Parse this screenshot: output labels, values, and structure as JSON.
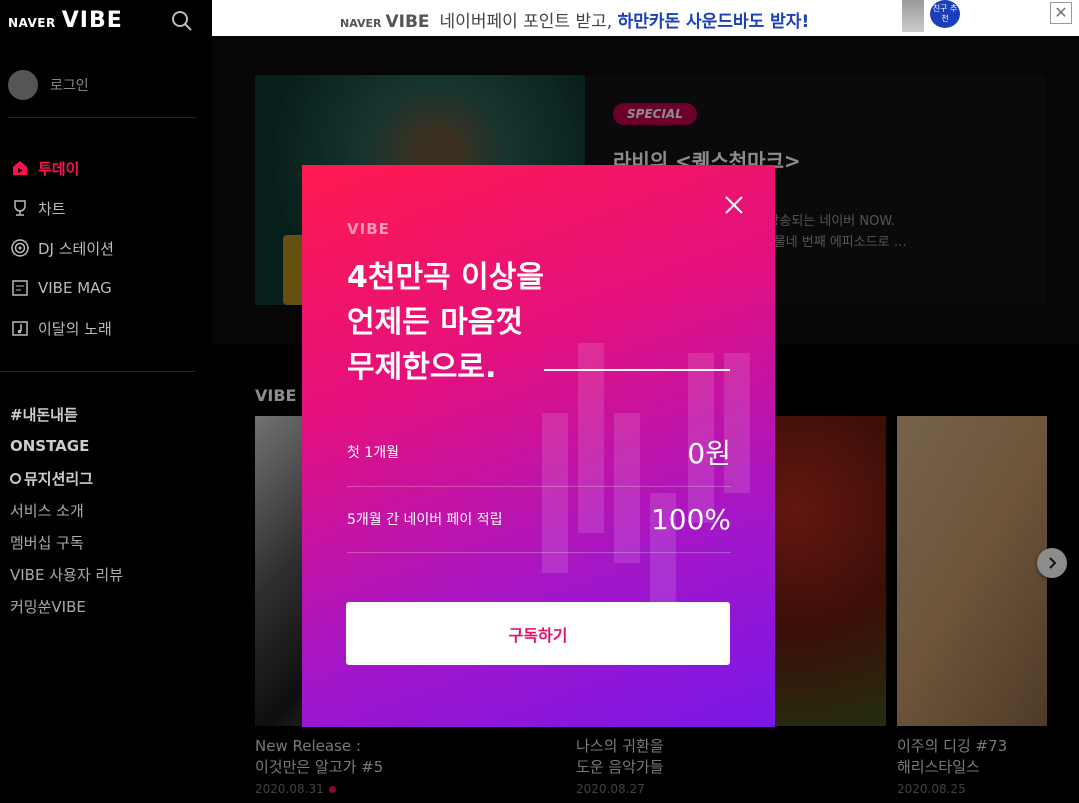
{
  "app": {
    "naver_label": "NAVER",
    "vibe_label": "VIBE"
  },
  "sidebar": {
    "login_label": "로그인",
    "nav": [
      {
        "label": "투데이",
        "icon": "home-icon",
        "active": true
      },
      {
        "label": "차트",
        "icon": "trophy-icon",
        "active": false
      },
      {
        "label": "DJ 스테이션",
        "icon": "radio-icon",
        "active": false
      },
      {
        "label": "VIBE MAG",
        "icon": "magazine-icon",
        "active": false
      },
      {
        "label": "이달의 노래",
        "icon": "music-note-icon",
        "active": false
      }
    ],
    "extras": [
      "#내돈내듣",
      "ONSTAGE",
      "뮤지션리그",
      "서비스 소개",
      "멤버십 구독",
      "VIBE 사용자 리뷰",
      "커밍쑨VIBE"
    ]
  },
  "banner": {
    "naver": "NAVER",
    "vibe": "VIBE",
    "text": "네이버페이 포인트 받고, ",
    "highlight": "하만카돈 사운드바도 받자!",
    "badge": "친구 추천",
    "close": "✕"
  },
  "hero": {
    "badge": "SPECIAL",
    "title": "라비의 <퀘스천마크>",
    "desc": "               요일 밤 7시에 생방송되는 네이버 NOW.\n               퀘스천마크>가 스물네 번째 에피소드로 …"
  },
  "section": {
    "title": "VIBE I"
  },
  "albums": [
    {
      "title": "New Release :\n이것만은 알고가 #5",
      "date": "2020.08.31",
      "new": true
    },
    {
      "title": "나스의 귀환을\n도운 음악가들",
      "date": "2020.08.27",
      "new": false
    },
    {
      "title": "이주의 디깅 #73\n해리스타일스",
      "date": "2020.08.25",
      "new": false
    }
  ],
  "modal": {
    "brand": "VIBE",
    "headline": [
      "4천만곡 이상을",
      "언제든 마음껏",
      "무제한으로."
    ],
    "offers": [
      {
        "label": "첫 1개월",
        "value": "0원"
      },
      {
        "label": "5개월 간 네이버 페이 적립",
        "value": "100%"
      }
    ],
    "subscribe_label": "구독하기"
  },
  "colors": {
    "accent": "#ff1150",
    "modal_start": "#ff1a4f",
    "modal_end": "#7a17e8",
    "banner_highlight": "#1a3fb8"
  }
}
